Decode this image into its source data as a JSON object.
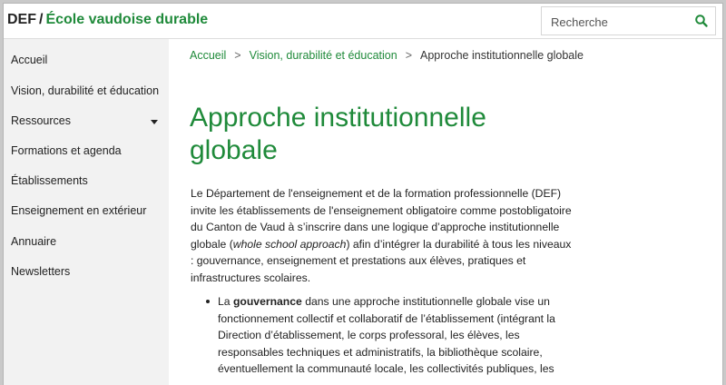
{
  "header": {
    "prefix": "DEF",
    "separator": "/",
    "site_name": "École vaudoise durable",
    "search_placeholder": "Recherche"
  },
  "sidebar": {
    "items": [
      {
        "label": "Accueil"
      },
      {
        "label": "Vision, durabilité et éducation"
      },
      {
        "label": "Ressources",
        "has_submenu": true
      },
      {
        "label": "Formations et agenda"
      },
      {
        "label": "Établissements"
      },
      {
        "label": "Enseignement en extérieur"
      },
      {
        "label": "Annuaire"
      },
      {
        "label": "Newsletters"
      }
    ]
  },
  "breadcrumb": {
    "items": [
      "Accueil",
      "Vision, durabilité et éducation"
    ],
    "separator": ">",
    "current": "Approche institutionnelle globale"
  },
  "page": {
    "title": "Approche institutionnelle globale",
    "intro_before_em": "Le Département de l'enseignement et de la formation professionnelle (DEF) invite les établissements de l'enseignement obligatoire comme postobligatoire du Canton de Vaud à s’inscrire dans une logique d’approche institutionnelle globale (",
    "intro_em": "whole school approach",
    "intro_after_em": ") afin d’intégrer la durabilité à tous les niveaux : gouvernance, enseignement et prestations aux élèves, pratiques et infrastructures scolaires.",
    "bullet_1_before": "La ",
    "bullet_1_strong": "gouvernance",
    "bullet_1_after": " dans une approche institutionnelle globale vise un fonctionnement collectif et collaboratif de l’établissement (intégrant la Direction d’établissement, le corps professoral, les élèves, les responsables techniques et administratifs, la bibliothèque scolaire, éventuellement la communauté locale, les collectivités publiques, les"
  },
  "colors": {
    "brand_green": "#1f8a3a",
    "sidebar_bg": "#f2f2f2"
  }
}
